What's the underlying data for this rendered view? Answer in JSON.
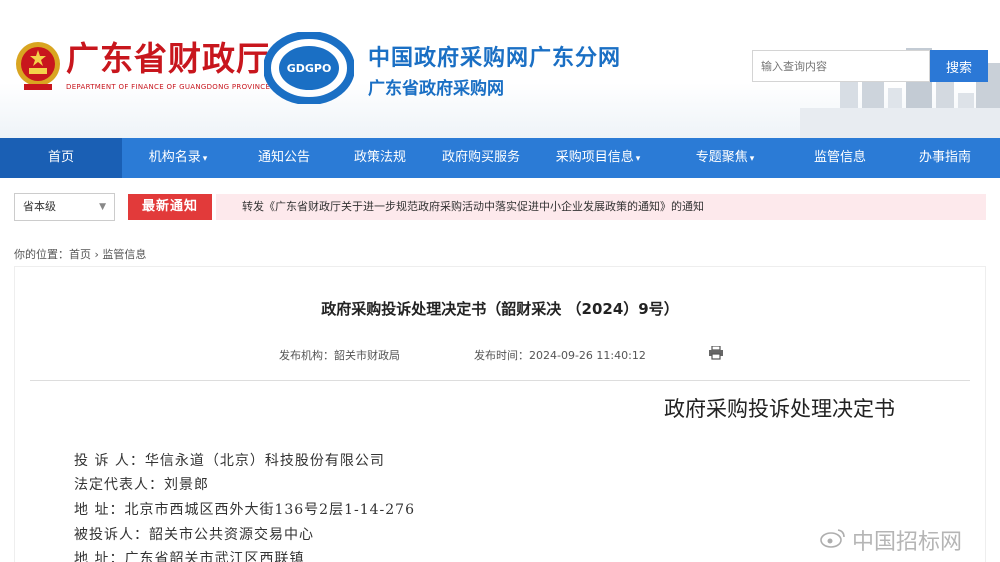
{
  "header": {
    "dept_name": "广东省财政厅",
    "dept_name_en": "DEPARTMENT OF FINANCE OF GUANGDONG PROVINCE",
    "logo_text": "GDGPO",
    "site_title": "中国政府采购网广东分网",
    "site_subtitle": "广东省政府采购网",
    "search_placeholder": "输入查询内容",
    "search_button": "搜索"
  },
  "nav": {
    "items": [
      {
        "label": "首页"
      },
      {
        "label": "机构名录"
      },
      {
        "label": "通知公告"
      },
      {
        "label": "政策法规"
      },
      {
        "label": "政府购买服务"
      },
      {
        "label": "采购项目信息"
      },
      {
        "label": "专题聚焦"
      },
      {
        "label": "监管信息"
      },
      {
        "label": "办事指南"
      }
    ]
  },
  "notice": {
    "level_select": "省本级",
    "badge": "最新通知",
    "text": "转发《广东省财政厅关于进一步规范政府采购活动中落实促进中小企业发展政策的通知》的通知"
  },
  "breadcrumb": {
    "prefix": "你的位置：",
    "home": "首页",
    "sep": " › ",
    "current": "监管信息"
  },
  "article": {
    "title": "政府采购投诉处理决定书（韶财采决 （2024）9号）",
    "publisher_label": "发布机构：",
    "publisher": "韶关市财政局",
    "time_label": "发布时间：",
    "time": "2024-09-26 11:40:12",
    "body_heading": "政府采购投诉处理决定书",
    "lines": [
      "投 诉 人：华信永道（北京）科技股份有限公司",
      "法定代表人：刘景郎",
      "地  址：北京市西城区西外大街136号2层1-14-276",
      "被投诉人：韶关市公共资源交易中心",
      "地  址：广东省韶关市武江区西联镇"
    ]
  },
  "watermark": "中国招标网",
  "colors": {
    "brand_red": "#c8161d",
    "brand_blue": "#1a6fc4",
    "nav_blue": "#2b7bd6",
    "nav_active": "#1a5fb4",
    "notice_red": "#e23a3a"
  }
}
